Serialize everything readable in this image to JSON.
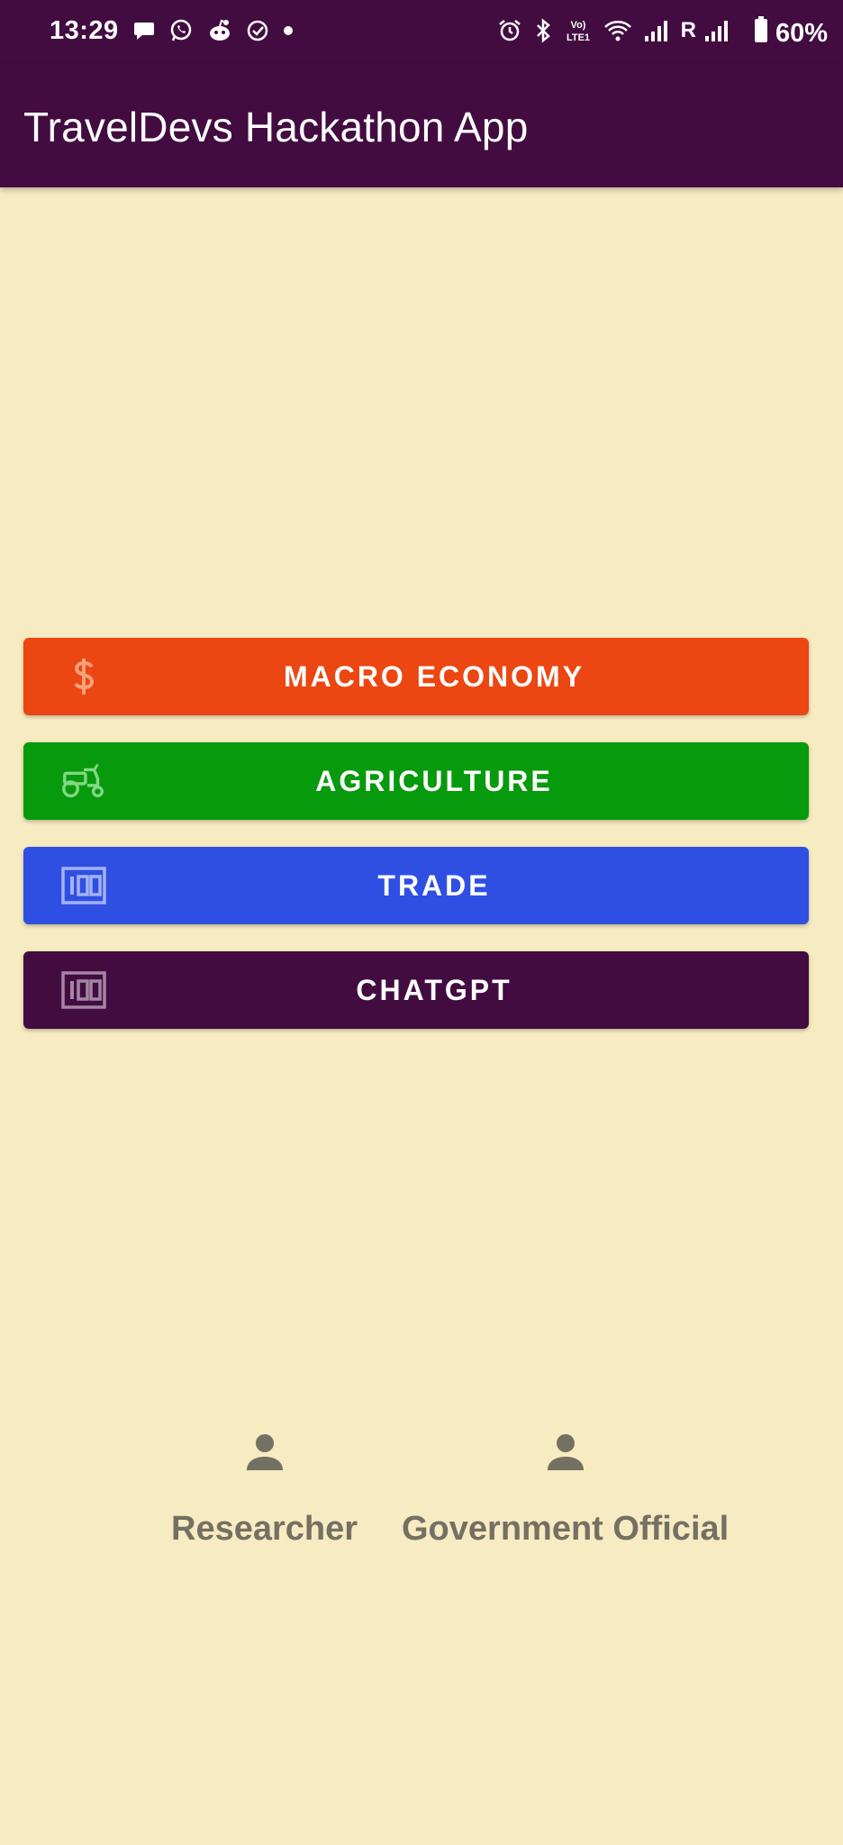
{
  "status_bar": {
    "time": "13:29",
    "battery": "60%",
    "left_icons": [
      "chat-bubble-icon",
      "whatsapp-icon",
      "reddit-icon",
      "check-circle-icon",
      "dot-icon"
    ],
    "right_icons": [
      "alarm-icon",
      "bluetooth-icon",
      "volte-icon",
      "wifi-icon",
      "signal-icon",
      "roaming-signal-icon",
      "battery-icon"
    ],
    "roaming_letter": "R",
    "volte_top": "Vo)",
    "volte_bottom": "LTE1"
  },
  "app_bar": {
    "title": "TravelDevs Hackathon App"
  },
  "menu": {
    "buttons": [
      {
        "label": "MACRO ECONOMY",
        "icon": "dollar-icon",
        "color": "#ec4612"
      },
      {
        "label": "AGRICULTURE",
        "icon": "tractor-icon",
        "color": "#079a0c"
      },
      {
        "label": "TRADE",
        "icon": "counter-100-icon",
        "color": "#2f4fe3"
      },
      {
        "label": "CHATGPT",
        "icon": "counter-100-icon",
        "color": "#420c41"
      }
    ]
  },
  "roles": [
    {
      "label": "Researcher",
      "icon": "person-icon"
    },
    {
      "label": "Government Official",
      "icon": "person-icon"
    }
  ],
  "colors": {
    "primary": "#420c41",
    "background": "#f7ebc1",
    "role_text": "#747063"
  }
}
